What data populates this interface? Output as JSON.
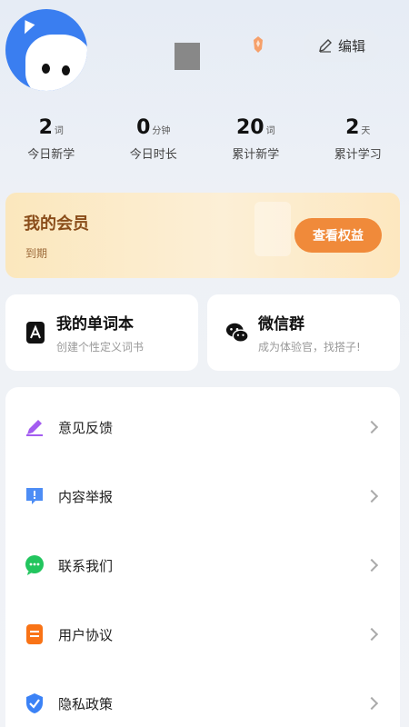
{
  "header": {
    "edit_label": "编辑"
  },
  "stats": [
    {
      "value": "2",
      "unit": "词",
      "label": "今日新学"
    },
    {
      "value": "0",
      "unit": "分钟",
      "label": "今日时长"
    },
    {
      "value": "20",
      "unit": "词",
      "label": "累计新学"
    },
    {
      "value": "2",
      "unit": "天",
      "label": "累计学习"
    }
  ],
  "membership": {
    "title": "我的会员",
    "subtitle": "到期",
    "button": "查看权益"
  },
  "cards": [
    {
      "title": "我的单词本",
      "desc": "创建个性定义词书",
      "icon": "wordbook-icon"
    },
    {
      "title": "微信群",
      "desc": "成为体验官，找搭子!",
      "icon": "wechat-icon"
    }
  ],
  "menu": [
    {
      "label": "意见反馈",
      "icon": "feedback-pen-icon",
      "color": "#a35cf0"
    },
    {
      "label": "内容举报",
      "icon": "report-alert-icon",
      "color": "#4d8df5"
    },
    {
      "label": "联系我们",
      "icon": "chat-bubble-icon",
      "color": "#22c55e"
    },
    {
      "label": "用户协议",
      "icon": "document-icon",
      "color": "#f97316"
    },
    {
      "label": "隐私政策",
      "icon": "shield-check-icon",
      "color": "#3b82f6"
    }
  ],
  "colors": {
    "accent": "#f08a3a",
    "member_text": "#8a4d1a"
  }
}
